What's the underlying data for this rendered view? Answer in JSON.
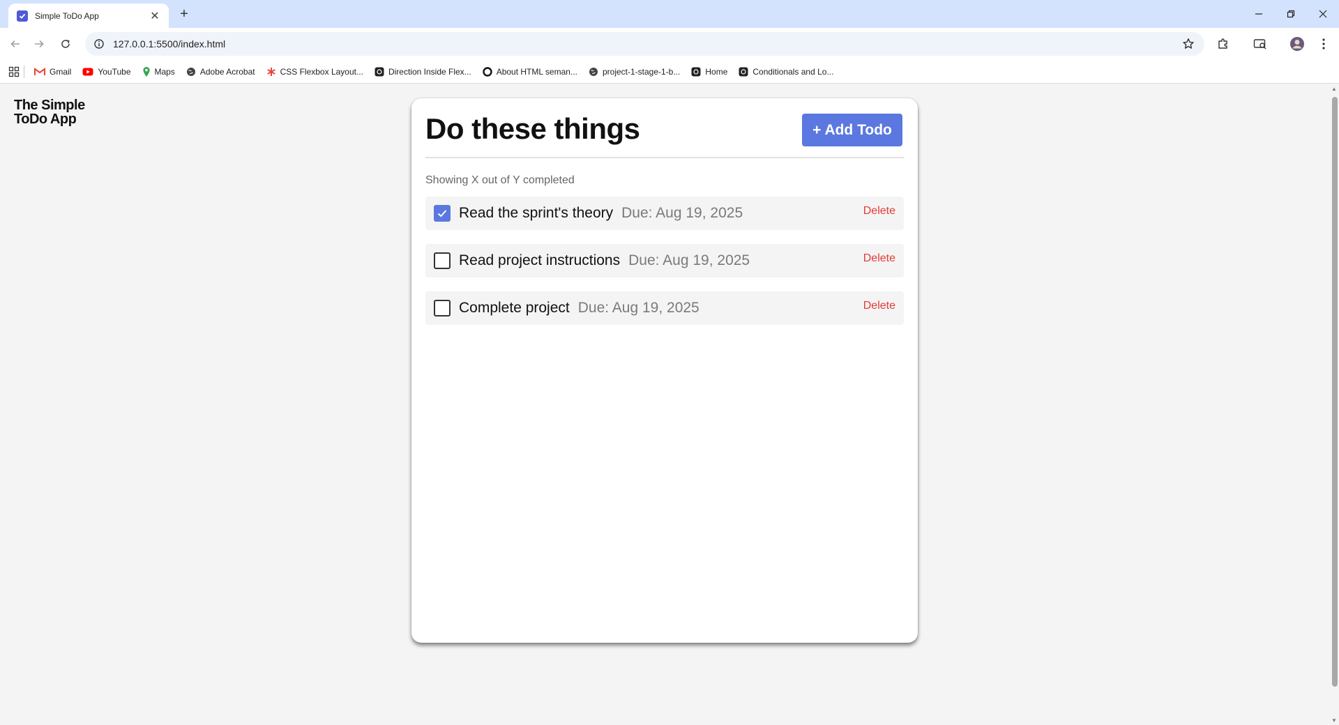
{
  "browser": {
    "tab_title": "Simple ToDo App",
    "new_tab_label": "+",
    "url": "127.0.0.1:5500/index.html",
    "bookmarks": [
      {
        "label": "Gmail",
        "icon": "gmail-icon"
      },
      {
        "label": "YouTube",
        "icon": "youtube-icon"
      },
      {
        "label": "Maps",
        "icon": "maps-icon"
      },
      {
        "label": "Adobe Acrobat",
        "icon": "globe-icon"
      },
      {
        "label": "CSS Flexbox Layout...",
        "icon": "asterisk-icon"
      },
      {
        "label": "Direction Inside Flex...",
        "icon": "site-icon"
      },
      {
        "label": "About HTML seman...",
        "icon": "circle-icon"
      },
      {
        "label": "project-1-stage-1-b...",
        "icon": "globe-icon"
      },
      {
        "label": "Home",
        "icon": "site-icon"
      },
      {
        "label": "Conditionals and Lo...",
        "icon": "site-icon"
      }
    ]
  },
  "app": {
    "title_line1": "The Simple",
    "title_line2": "ToDo App"
  },
  "card": {
    "title": "Do these things",
    "add_button": "+ Add Todo",
    "summary": "Showing X out of Y completed",
    "delete_label": "Delete",
    "todos": [
      {
        "text": "Read the sprint's theory",
        "due": "Due: Aug 19, 2025",
        "completed": true
      },
      {
        "text": "Read project instructions",
        "due": "Due: Aug 19, 2025",
        "completed": false
      },
      {
        "text": "Complete project",
        "due": "Due: Aug 19, 2025",
        "completed": false
      }
    ]
  },
  "colors": {
    "accent": "#5b78e0",
    "delete": "#e53935",
    "tabbar": "#d3e3fd"
  }
}
